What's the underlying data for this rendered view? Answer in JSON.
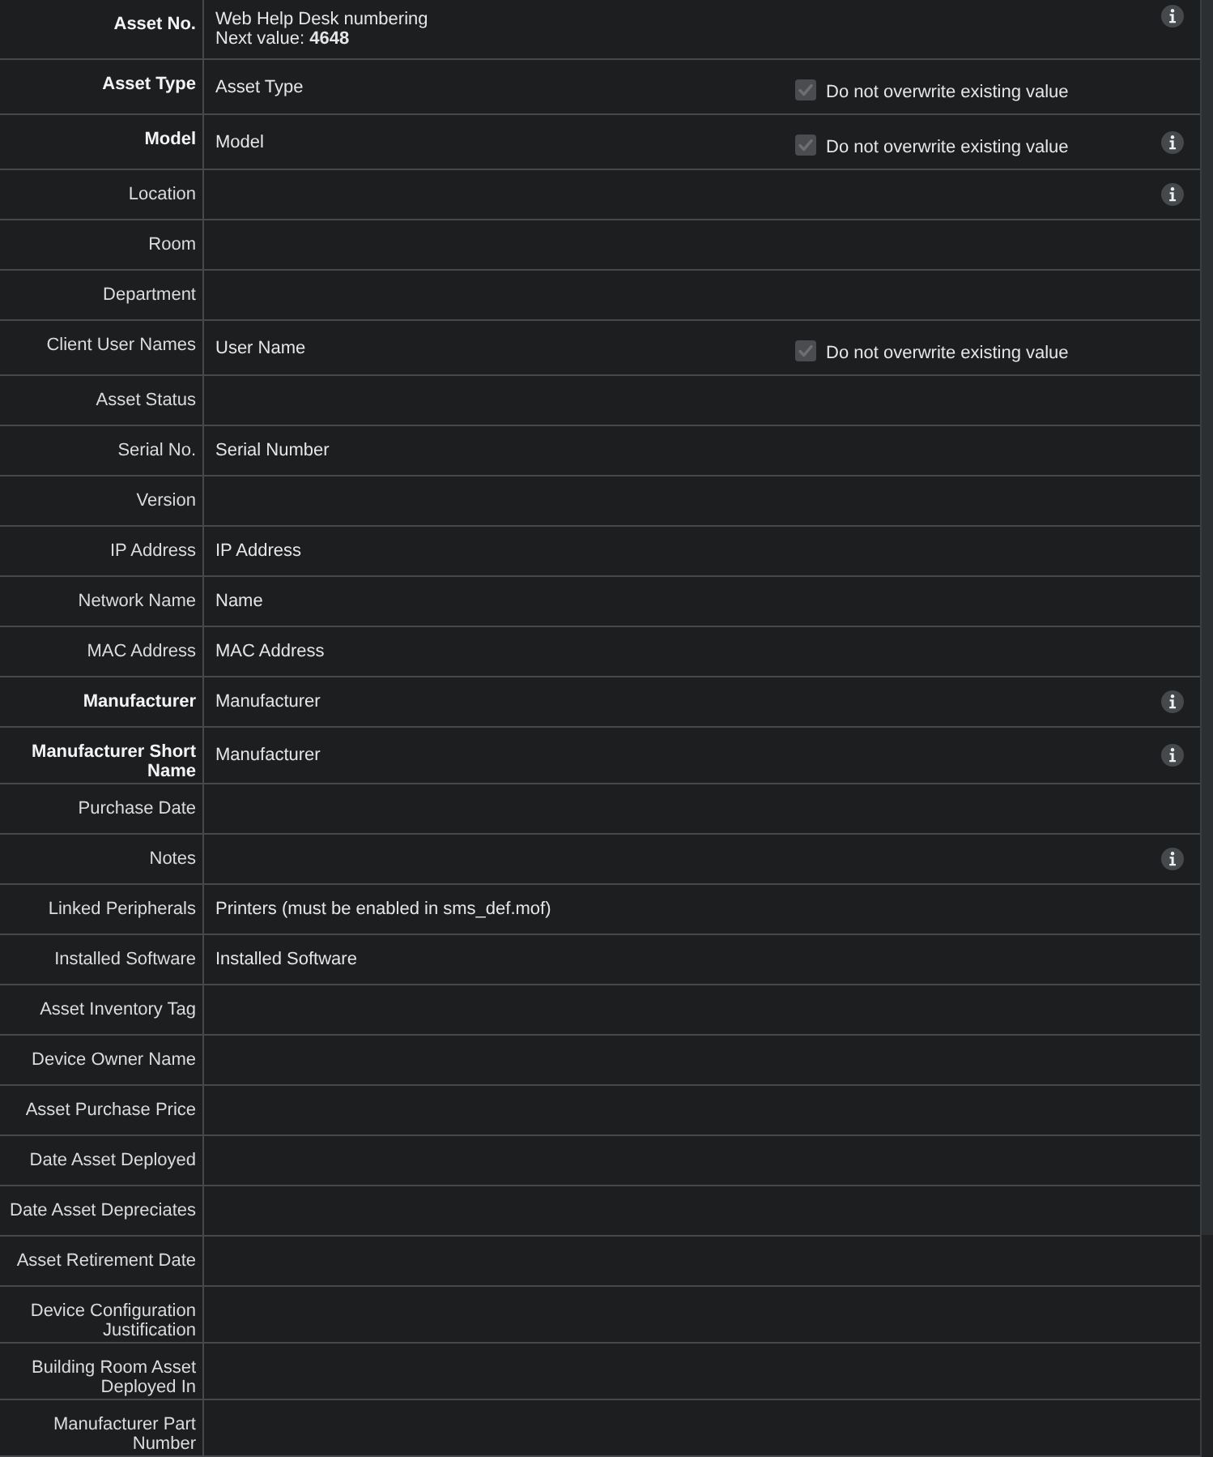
{
  "fields": [
    {
      "label": "Asset No.",
      "required": true,
      "value": "Web Help Desk numbering",
      "note": "Next value: **4648**",
      "info": true
    },
    {
      "label": "Asset Type",
      "required": true,
      "value": "Asset Type",
      "option": {
        "label": "Do not overwrite existing value",
        "checked": true,
        "disabled": true
      },
      "info": false
    },
    {
      "label": "Model",
      "required": true,
      "value": "Model",
      "option": {
        "label": "Do not overwrite existing value",
        "checked": true,
        "disabled": true
      },
      "info": true
    },
    {
      "label": "Location",
      "required": false,
      "info": true
    },
    {
      "label": "Room",
      "required": false,
      "info": false
    },
    {
      "label": "Department",
      "required": false,
      "info": false
    },
    {
      "label": "Client User Names",
      "required": false,
      "value": "User Name",
      "option": {
        "label": "Do not overwrite existing value",
        "checked": true,
        "disabled": true
      },
      "info": false
    },
    {
      "label": "Asset Status",
      "required": false,
      "info": false
    },
    {
      "label": "Serial No.",
      "required": false,
      "value": "Serial Number",
      "info": false
    },
    {
      "label": "Version",
      "required": false,
      "info": false
    },
    {
      "label": "IP Address",
      "required": false,
      "value": "IP Address",
      "info": false
    },
    {
      "label": "Network Name",
      "required": false,
      "value": "Name",
      "info": false
    },
    {
      "label": "MAC Address",
      "required": false,
      "value": "MAC Address",
      "info": false
    },
    {
      "label": "Manufacturer",
      "required": true,
      "value": "Manufacturer",
      "info": true
    },
    {
      "label": "Manufacturer Short Name",
      "required": true,
      "value": "Manufacturer",
      "info": true
    },
    {
      "label": "Purchase Date",
      "required": false,
      "info": false
    },
    {
      "label": "Notes",
      "required": false,
      "info": true
    },
    {
      "label": "Linked Peripherals",
      "required": false,
      "value": "Printers (must be enabled in sms_def.mof)",
      "info": false
    },
    {
      "label": "Installed Software",
      "required": false,
      "value": "Installed Software",
      "info": false
    },
    {
      "label": "Asset Inventory Tag",
      "required": false,
      "info": false
    },
    {
      "label": "Device Owner Name",
      "required": false,
      "info": false
    },
    {
      "label": "Asset Purchase Price",
      "required": false,
      "info": false
    },
    {
      "label": "Date Asset Deployed",
      "required": false,
      "info": false
    },
    {
      "label": "Date Asset Depreciates",
      "required": false,
      "info": false
    },
    {
      "label": "Asset Retirement Date",
      "required": false,
      "info": false
    },
    {
      "label": "Device Configuration Justification",
      "required": false,
      "info": false
    },
    {
      "label": "Building Room Asset Deployed In",
      "required": false,
      "info": false
    },
    {
      "label": "Manufacturer Part Number",
      "required": false,
      "info": false
    }
  ]
}
